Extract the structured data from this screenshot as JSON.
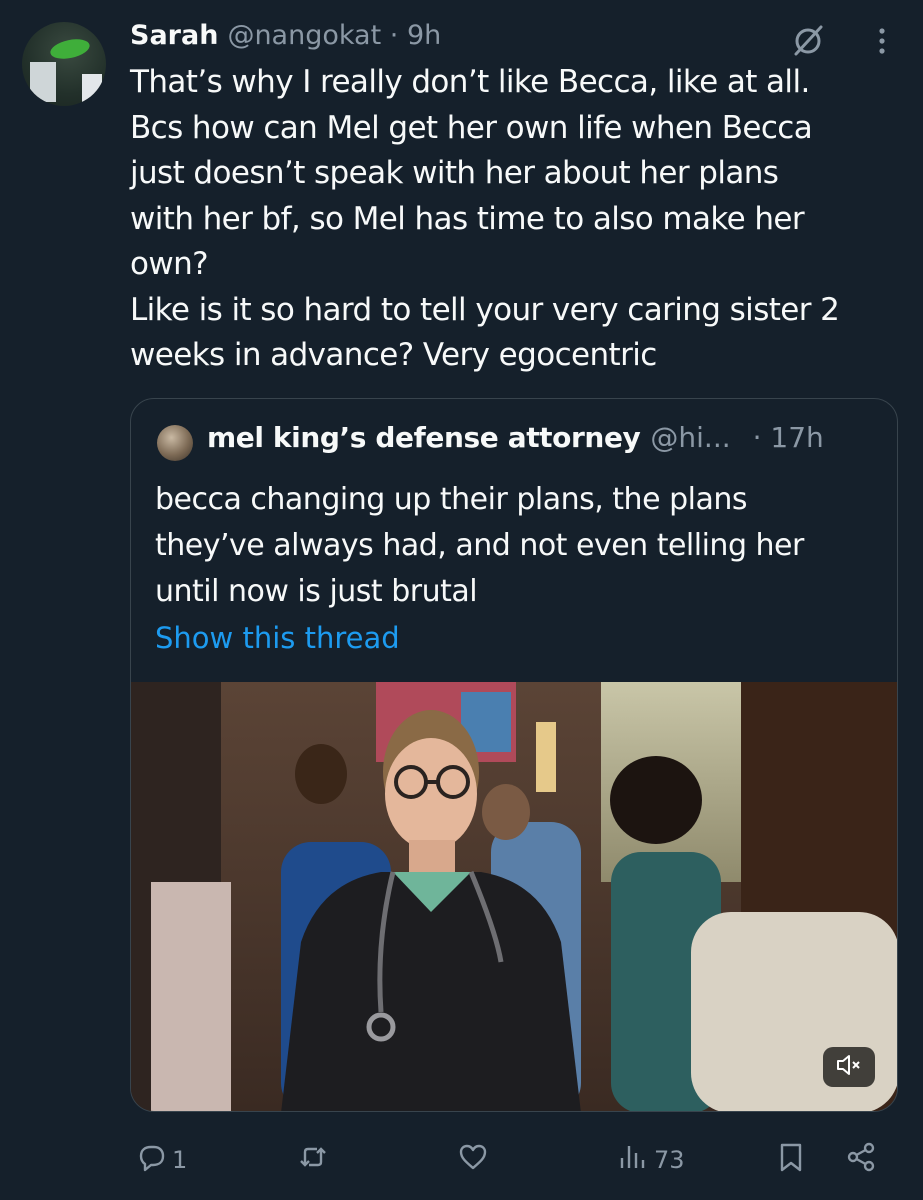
{
  "tweet": {
    "author_name": "Sarah",
    "author_handle": "@nangokat",
    "separator": "·",
    "time": "9h",
    "text_lines": [
      "That’s why I really don’t like Becca, like at all.",
      "Bcs how can Mel get her own life when Becca",
      "just doesn’t speak with her about her plans",
      "with her bf, so Mel has time to also make her",
      "own?",
      "Like is it so hard to tell your very caring sister 2",
      "weeks in advance? Very egocentric"
    ]
  },
  "quoted": {
    "author_name": "mel king’s defense attorney",
    "author_handle": "@hi...",
    "time": "· 17h",
    "text_lines": [
      "becca changing up their plans, the plans",
      "they’ve always had, and not even telling her",
      "until now is just brutal"
    ],
    "show_thread": "Show this thread",
    "media": {
      "type": "video",
      "muted_icon": "speaker-muted-icon"
    }
  },
  "actions": {
    "reply_count": "1",
    "repost_count": "",
    "like_count": "",
    "views_count": "73"
  },
  "icons": {
    "header": [
      "grok-icon",
      "more-icon"
    ],
    "actions": [
      "reply-icon",
      "repost-icon",
      "like-icon",
      "views-icon",
      "bookmark-icon",
      "share-icon"
    ]
  },
  "colors": {
    "background": "#15202b",
    "text": "#f7f9f9",
    "secondary": "#8b98a5",
    "link": "#1d9bf0",
    "border": "#38444d"
  }
}
